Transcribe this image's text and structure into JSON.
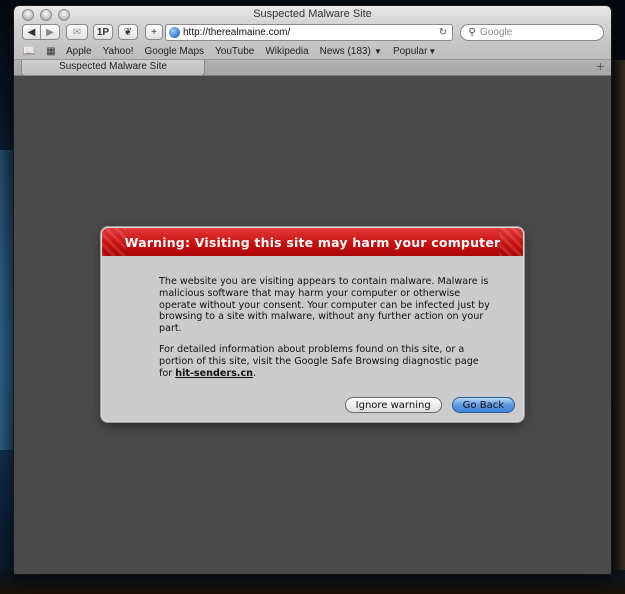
{
  "window": {
    "title": "Suspected Malware Site"
  },
  "toolbar": {
    "back_icon": "back-arrow-icon",
    "forward_icon": "forward-arrow-icon",
    "onepassword_label": "1P",
    "add_label": "+",
    "url": "http://therealmaine.com/",
    "search_placeholder": "Google"
  },
  "bookmarks": {
    "items": [
      "Apple",
      "Yahoo!",
      "Google Maps",
      "YouTube",
      "Wikipedia",
      "News (183)",
      "Popular"
    ]
  },
  "tab": {
    "label": "Suspected Malware Site",
    "new_tab": "+"
  },
  "dialog": {
    "title": "Warning: Visiting this site may harm your computer",
    "paragraph1": "The website you are visiting appears to contain malware. Malware is malicious software that may harm your computer or otherwise operate without your consent. Your computer can be infected just by browsing to a site with malware, without any further action on your part.",
    "paragraph2_prefix": "For detailed information about problems found on this site, or a portion of this site, visit the Google Safe Browsing diagnostic page for ",
    "link": "hit-senders.cn",
    "paragraph2_suffix": ".",
    "ignore_label": "Ignore warning",
    "back_label": "Go Back",
    "accent_color": "#c81010"
  }
}
